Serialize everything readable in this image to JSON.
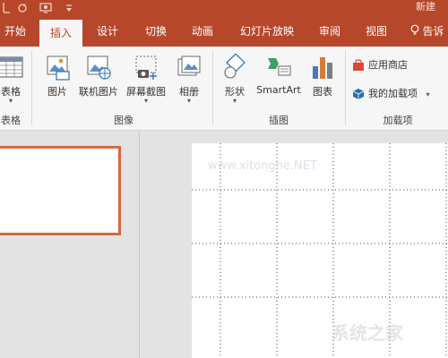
{
  "titlebar": {
    "doc_title": "新建",
    "qat_icons": [
      "undo-icon",
      "redo-icon",
      "from-beginning-icon",
      "customize-qat-icon"
    ]
  },
  "tabs": [
    {
      "label": "开始",
      "active": false
    },
    {
      "label": "插入",
      "active": true
    },
    {
      "label": "设计",
      "active": false
    },
    {
      "label": "切换",
      "active": false
    },
    {
      "label": "动画",
      "active": false
    },
    {
      "label": "幻灯片放映",
      "active": false
    },
    {
      "label": "审阅",
      "active": false
    },
    {
      "label": "视图",
      "active": false
    },
    {
      "label": "告诉",
      "active": false,
      "icon": "lightbulb-icon"
    }
  ],
  "ribbon": {
    "table": {
      "button": "表格",
      "group": "表格"
    },
    "images": {
      "group": "图像",
      "buttons": [
        "图片",
        "联机图片",
        "屏幕截图",
        "相册"
      ]
    },
    "illustrations": {
      "group": "插图",
      "buttons": [
        "形状",
        "SmartArt",
        "图表"
      ]
    },
    "addins": {
      "group": "加载项",
      "store": "应用商店",
      "my_addins": "我的加载项"
    }
  },
  "colors": {
    "accent": "#b7472a",
    "ribbon_bg": "#f6f6f6",
    "workspace_bg": "#e3e3e3",
    "thumb_border": "#d9673f"
  },
  "watermark": {
    "site_text": "www.xitonghe.NET",
    "brand_text": "系统之家"
  }
}
